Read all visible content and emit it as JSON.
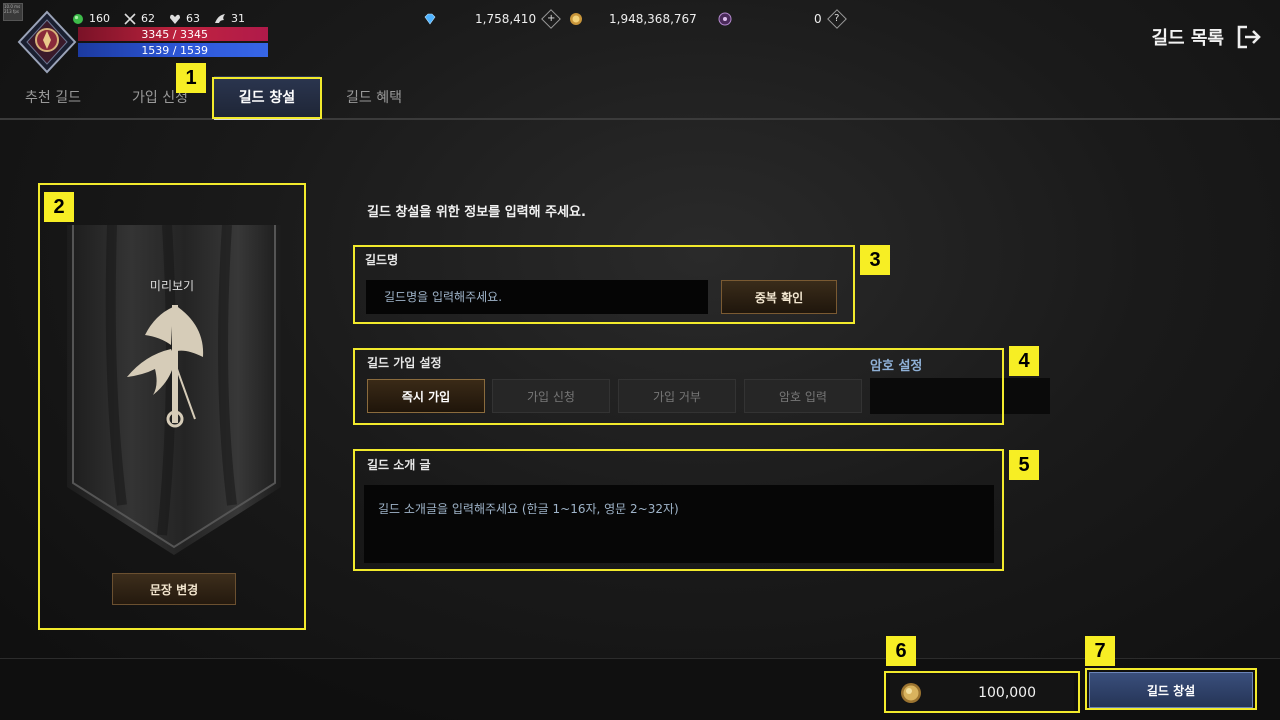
{
  "hud": {
    "tiny_label": "10.0 ms 213 fps",
    "stats": [
      {
        "icon": "green-orb-icon",
        "value": "160"
      },
      {
        "icon": "crossed-swords-icon",
        "value": "62"
      },
      {
        "icon": "heart-shield-icon",
        "value": "63"
      },
      {
        "icon": "wing-icon",
        "value": "31"
      }
    ],
    "hp": "3345 / 3345",
    "mp": "1539 / 1539",
    "diamond_value": "1,758,410",
    "gold_value": "1,948,368,767",
    "token_value": "0",
    "guild_list_label": "길드 목록"
  },
  "tabs": [
    {
      "label": "추천 길드",
      "active": false
    },
    {
      "label": "가입 신청",
      "active": false
    },
    {
      "label": "길드 창설",
      "active": true
    },
    {
      "label": "길드 혜택",
      "active": false
    }
  ],
  "banner": {
    "preview_label": "미리보기",
    "change_button": "문장 변경"
  },
  "form": {
    "intro": "길드 창설을 위한 정보를 입력해 주세요.",
    "name_label": "길드명",
    "name_placeholder": "길드명을 입력해주세요.",
    "dup_check_button": "중복 확인",
    "join_label": "길드 가입 설정",
    "join_options": [
      {
        "label": "즉시 가입",
        "selected": true
      },
      {
        "label": "가입 신청",
        "selected": false
      },
      {
        "label": "가입 거부",
        "selected": false
      },
      {
        "label": "암호 입력",
        "selected": false
      }
    ],
    "password_label": "암호 설정",
    "intro_label": "길드 소개 글",
    "intro_placeholder": "길드 소개글을 입력해주세요 (한글 1~16자, 영문 2~32자)"
  },
  "footer": {
    "cost": "100,000",
    "create_button": "길드 창설"
  },
  "callouts": [
    "1",
    "2",
    "3",
    "4",
    "5",
    "6",
    "7"
  ],
  "colors": {
    "highlight": "#f2ea2c",
    "accent_blue": "#8fb0d6",
    "hp": "#c0233f",
    "mp": "#2d57d8"
  }
}
